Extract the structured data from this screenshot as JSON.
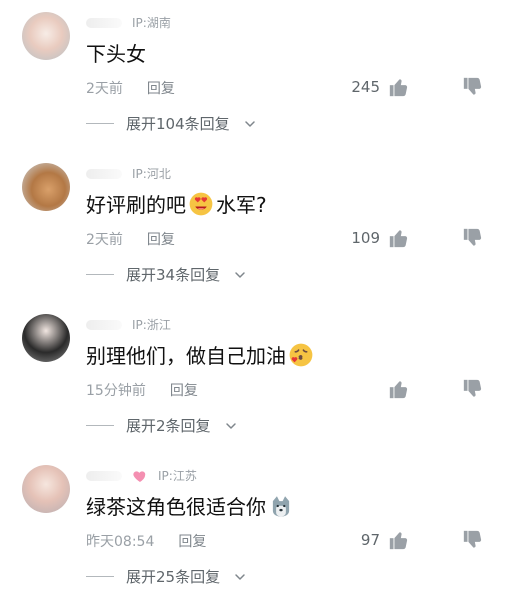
{
  "comments": [
    {
      "ip": "IP:湖南",
      "text": "下头女",
      "time": "2天前",
      "reply_label": "回复",
      "likes": "245",
      "expand_label": "展开104条回复"
    },
    {
      "ip": "IP:河北",
      "text_before": "好评刷的吧",
      "text_after": "水军?",
      "time": "2天前",
      "reply_label": "回复",
      "likes": "109",
      "expand_label": "展开34条回复"
    },
    {
      "ip": "IP:浙江",
      "text": "别理他们，做自己加油",
      "time": "15分钟前",
      "reply_label": "回复",
      "likes": "",
      "expand_label": "展开2条回复"
    },
    {
      "ip": "IP:江苏",
      "text": "绿茶这角色很适合你",
      "time": "昨天08:54",
      "reply_label": "回复",
      "likes": "97",
      "expand_label": "展开25条回复"
    }
  ],
  "icons": {
    "like": "thumbs-up-icon",
    "dislike": "thumbs-down-icon",
    "chevron": "chevron-down-icon"
  },
  "colors": {
    "meta": "#9aa0a6",
    "text": "#111111",
    "icon": "#8f969b"
  }
}
